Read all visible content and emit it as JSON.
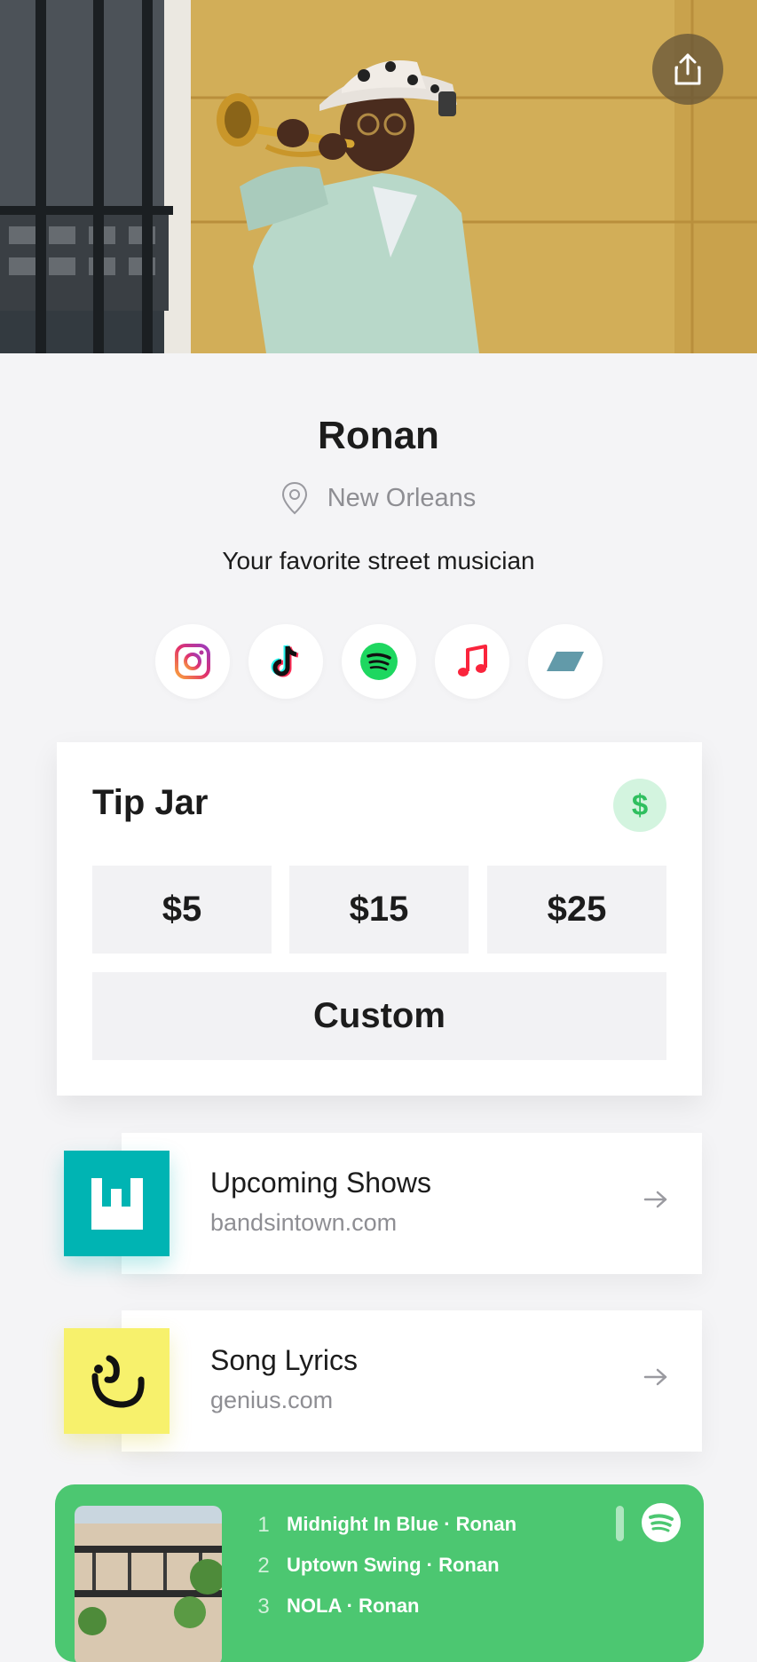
{
  "profile": {
    "name": "Ronan",
    "location": "New Orleans",
    "bio": "Your favorite street musician"
  },
  "socials": [
    {
      "icon": "instagram-icon"
    },
    {
      "icon": "tiktok-icon"
    },
    {
      "icon": "spotify-icon"
    },
    {
      "icon": "apple-music-icon"
    },
    {
      "icon": "bandcamp-icon"
    }
  ],
  "tipjar": {
    "title": "Tip Jar",
    "currency_symbol": "$",
    "amounts": [
      "$5",
      "$15",
      "$25"
    ],
    "custom_label": "Custom"
  },
  "links": [
    {
      "title": "Upcoming Shows",
      "subtitle": "bandsintown.com",
      "icon": "bandsintown-icon",
      "color": "#00b4b3"
    },
    {
      "title": "Song Lyrics",
      "subtitle": "genius.com",
      "icon": "genius-icon",
      "color": "#f7f16c"
    }
  ],
  "spotify": {
    "color": "#4cc771",
    "tracks": [
      {
        "num": "1",
        "title": "Midnight In Blue · Ronan"
      },
      {
        "num": "2",
        "title": "Uptown Swing · Ronan"
      },
      {
        "num": "3",
        "title": "NOLA · Ronan"
      }
    ]
  },
  "colors": {
    "background": "#f4f4f6",
    "accent_green": "#2fbf5f",
    "text": "#1c1c1c",
    "muted": "#8e8e93"
  }
}
